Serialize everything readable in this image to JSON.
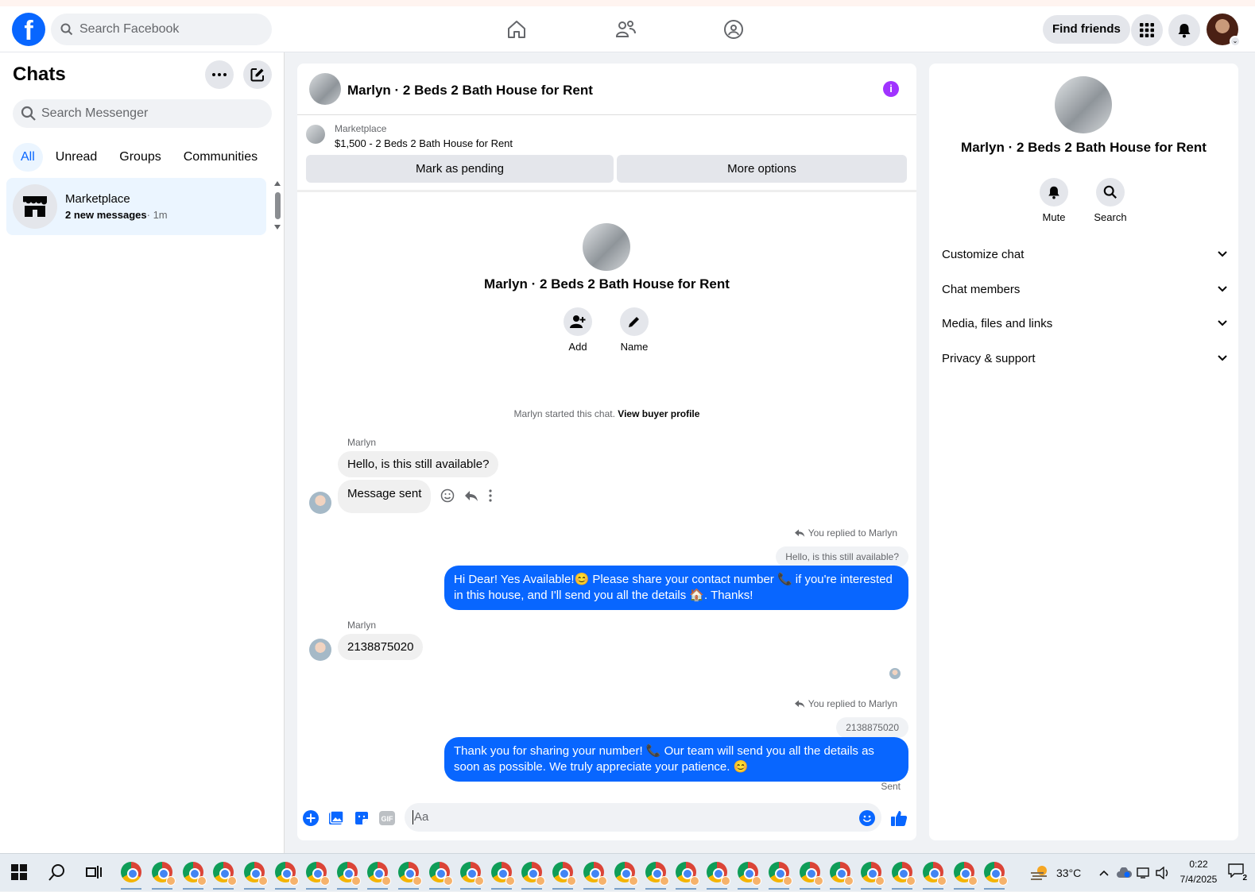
{
  "topbar": {
    "logo": "f",
    "search_placeholder": "Search Facebook",
    "find_friends": "Find friends"
  },
  "left": {
    "title": "Chats",
    "search_placeholder": "Search Messenger",
    "filters": [
      "All",
      "Unread",
      "Groups",
      "Communities"
    ],
    "chat": {
      "name": "Marketplace",
      "unread": "2 new messages",
      "time": "· 1m"
    }
  },
  "conversation": {
    "title": "Marlyn · 2 Beds 2 Bath House for Rent",
    "marketplace_label": "Marketplace",
    "listing": "$1,500 - 2 Beds 2 Bath House for Rent",
    "mark_pending": "Mark as pending",
    "more_options": "More options",
    "intro_title": "Marlyn · 2 Beds 2 Bath House for Rent",
    "add_label": "Add",
    "name_label": "Name",
    "system_text": "Marlyn started this chat.",
    "system_link": "View buyer profile",
    "messages": [
      {
        "sender": "Marlyn",
        "text": "Hello, is this still available?"
      },
      {
        "text": "Message sent"
      },
      {
        "replied": "You replied to Marlyn",
        "quote": "Hello, is this still available?",
        "text": "Hi Dear! Yes Available!😊 Please share your contact number 📞 if you're interested in this house, and I'll send you all the details 🏠. Thanks!"
      },
      {
        "sender": "Marlyn",
        "text": "2138875020"
      },
      {
        "replied": "You replied to Marlyn",
        "quote": "2138875020",
        "text": "Thank you for sharing your number! 📞 Our team will send you all the details as soon as possible. We truly appreciate your patience. 😊"
      }
    ],
    "status": "Sent",
    "composer_placeholder": "Aa"
  },
  "details": {
    "title": "Marlyn · 2 Beds 2 Bath House for Rent",
    "mute": "Mute",
    "search": "Search",
    "sections": [
      "Customize chat",
      "Chat members",
      "Media, files and links",
      "Privacy & support"
    ]
  },
  "taskbar": {
    "temperature": "33°C",
    "time": "0:22",
    "date": "7/4/2025",
    "notifications": "2"
  },
  "colors": {
    "accent": "#0866ff",
    "info": "#a033ff",
    "bubble_out": "#0866ff"
  }
}
